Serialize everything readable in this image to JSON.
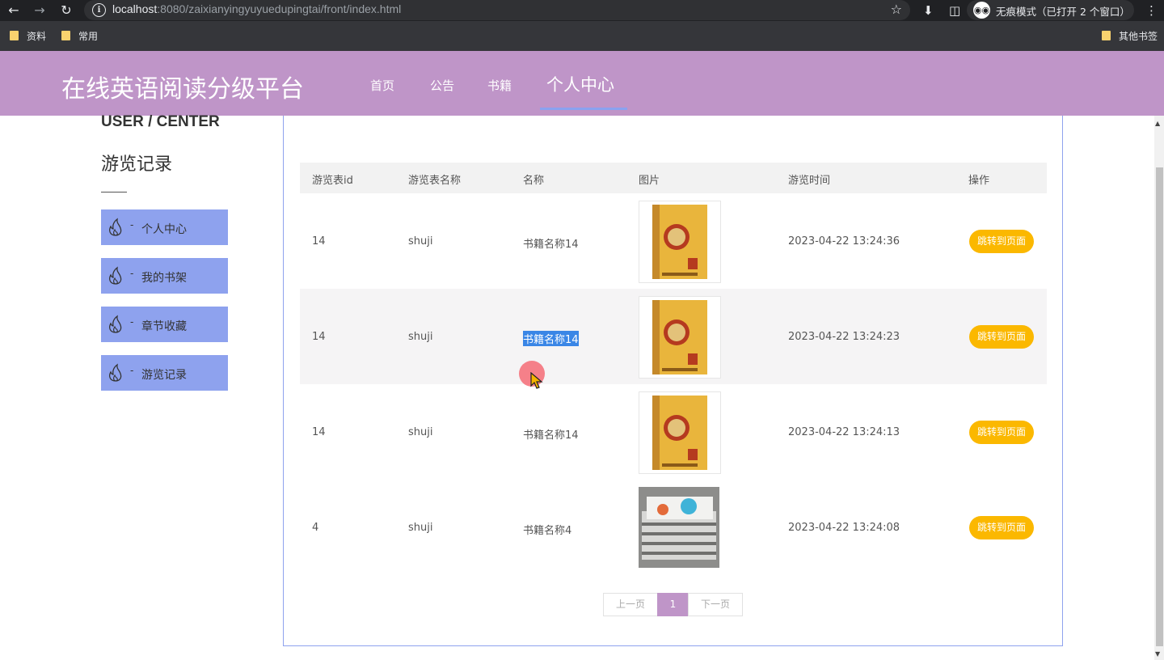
{
  "browser": {
    "url_host": "localhost",
    "url_rest": ":8080/zaixianyingyuyuedupingtai/front/index.html",
    "incognito_label": "无痕模式（已打开 2 个窗口）",
    "bookmarks": [
      "资料",
      "常用"
    ],
    "other_bookmarks": "其他书签"
  },
  "header": {
    "site_title": "在线英语阅读分级平台",
    "nav": [
      {
        "label": "首页"
      },
      {
        "label": "公告"
      },
      {
        "label": "书籍"
      },
      {
        "label": "个人中心"
      }
    ],
    "active_nav": "个人中心"
  },
  "sidebar": {
    "title_en": "USER / CENTER",
    "title_cn": "游览记录",
    "dash": "-",
    "items": [
      {
        "label": "个人中心"
      },
      {
        "label": "我的书架"
      },
      {
        "label": "章节收藏"
      },
      {
        "label": "游览记录"
      }
    ]
  },
  "table": {
    "columns": [
      "游览表id",
      "游览表名称",
      "名称",
      "图片",
      "游览时间",
      "操作"
    ],
    "rows": [
      {
        "id": "14",
        "table_name": "shuji",
        "name": "书籍名称14",
        "image": "book-cover-guoxue",
        "time": "2023-04-22 13:24:36",
        "action": "跳转到页面"
      },
      {
        "id": "14",
        "table_name": "shuji",
        "name": "书籍名称14",
        "image": "book-cover-guoxue",
        "time": "2023-04-22 13:24:23",
        "action": "跳转到页面"
      },
      {
        "id": "14",
        "table_name": "shuji",
        "name": "书籍名称14",
        "image": "book-cover-guoxue",
        "time": "2023-04-22 13:24:13",
        "action": "跳转到页面"
      },
      {
        "id": "4",
        "table_name": "shuji",
        "name": "书籍名称4",
        "image": "book-stack-photo",
        "time": "2023-04-22 13:24:08",
        "action": "跳转到页面"
      }
    ]
  },
  "pagination": {
    "prev": "上一页",
    "current": "1",
    "next": "下一页"
  },
  "colors": {
    "header_bg": "#bf95c8",
    "sidebar_item_bg": "#8ea2ee",
    "action_button": "#fbb800"
  }
}
